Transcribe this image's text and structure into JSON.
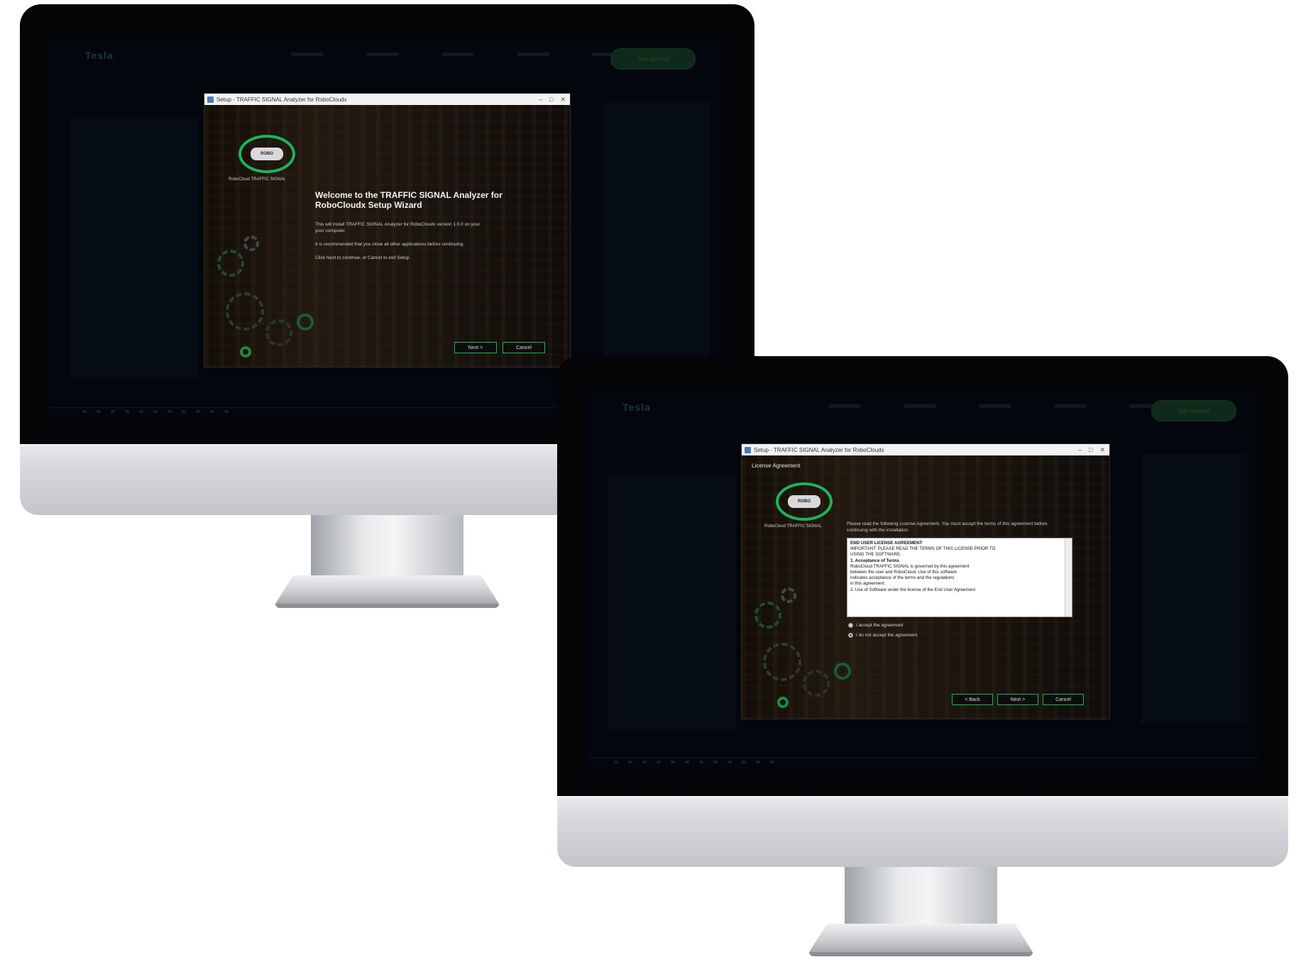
{
  "back_monitor": {
    "site": {
      "logo": "Tesla",
      "cta": "Get started"
    },
    "dialog": {
      "window_title": "Setup - TRAFFIC SIGNAL Analyzer for RoboCloudx",
      "logo_text": "ROBO",
      "logo_caption": "RoboCloud TRAFFIC SIGNAL",
      "heading": "Welcome to the TRAFFIC SIGNAL Analyzer for RoboCloudx Setup Wizard",
      "paragraphs": [
        "This will install TRAFFIC SIGNAL Analyzer for RoboCloudx version 1.0.0 on your",
        "your computer.",
        "It is recommended that you close all other applications before continuing.",
        "Click Next to continue, or Cancel to exit Setup."
      ],
      "buttons": {
        "next": "Next >",
        "cancel": "Cancel"
      }
    }
  },
  "front_monitor": {
    "site": {
      "logo": "Tesla",
      "cta": "Get started"
    },
    "dialog": {
      "window_title": "Setup - TRAFFIC SIGNAL Analyzer for RoboCloudx",
      "section_label": "License Agreement",
      "logo_text": "ROBO",
      "logo_caption": "RoboCloud TRAFFIC SIGNAL",
      "intro": "Please read the following License Agreement. You must accept the terms of this agreement before continuing with the installation.",
      "license_lines": [
        "END USER LICENSE AGREEMENT",
        "IMPORTANT: PLEASE READ THE TERMS OF THIS LICENSE PRIOR TO",
        "USING THE SOFTWARE.",
        "1.     Acceptance of Terms",
        "RoboCloud TRAFFIC SIGNAL is governed by this agreement",
        "between the user and RoboCloud. Use of this software",
        "indicates acceptance of the terms and the regulations",
        "in this agreement.",
        "2.     Use of Software under the license of the End User Agreement"
      ],
      "radio_accept": "I accept the agreement",
      "radio_decline": "I do not accept the agreement",
      "buttons": {
        "back": "< Back",
        "next": "Next >",
        "cancel": "Cancel"
      }
    }
  },
  "colors": {
    "accent_green": "#1db35a",
    "screen_bg": "#03070d",
    "bezel": "#050507",
    "chin_silver": "#d4d6d9"
  }
}
